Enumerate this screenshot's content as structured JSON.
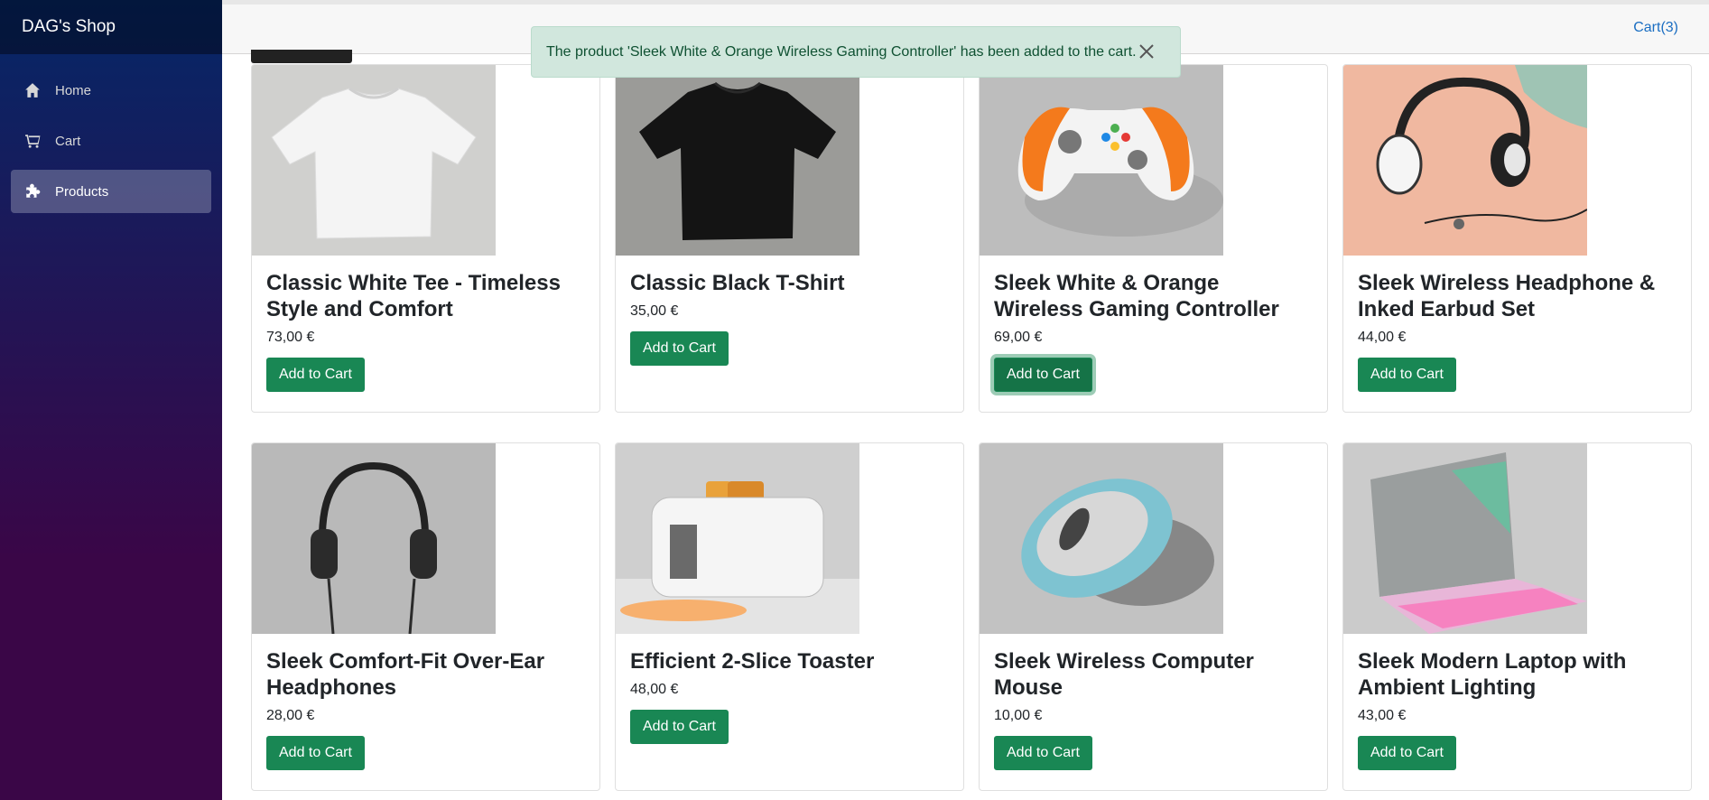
{
  "sidebar": {
    "brand": "DAG's Shop",
    "items": [
      {
        "label": "Home",
        "icon": "home-icon"
      },
      {
        "label": "Cart",
        "icon": "cart-icon"
      },
      {
        "label": "Products",
        "icon": "puzzle-icon"
      }
    ],
    "active": "Products"
  },
  "header": {
    "cart_link": "Cart(3)"
  },
  "toast": {
    "message": "The product 'Sleek White & Orange Wireless Gaming Controller' has been added to the cart."
  },
  "products": [
    {
      "name": "Classic White Tee - Timeless Style and Comfort",
      "price": "73,00 €",
      "button": "Add to Cart"
    },
    {
      "name": "Classic Black T-Shirt",
      "price": "35,00 €",
      "button": "Add to Cart"
    },
    {
      "name": "Sleek White & Orange Wireless Gaming Controller",
      "price": "69,00 €",
      "button": "Add to Cart"
    },
    {
      "name": "Sleek Wireless Headphone & Inked Earbud Set",
      "price": "44,00 €",
      "button": "Add to Cart"
    },
    {
      "name": "Sleek Comfort-Fit Over-Ear Headphones",
      "price": "28,00 €",
      "button": "Add to Cart"
    },
    {
      "name": "Efficient 2-Slice Toaster",
      "price": "48,00 €",
      "button": "Add to Cart"
    },
    {
      "name": "Sleek Wireless Computer Mouse",
      "price": "10,00 €",
      "button": "Add to Cart"
    },
    {
      "name": "Sleek Modern Laptop with Ambient Lighting",
      "price": "43,00 €",
      "button": "Add to Cart"
    }
  ],
  "colors": {
    "accent_button": "#198754",
    "link": "#1b6ec2",
    "toast_bg": "#d1e7dd",
    "sidebar_top": "#052767",
    "sidebar_bottom": "#3a0647"
  }
}
